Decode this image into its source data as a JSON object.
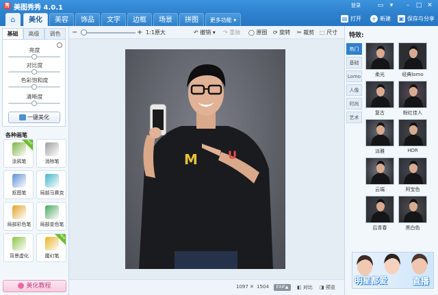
{
  "app": {
    "title": "美图秀秀 4.0.1",
    "login": "登录"
  },
  "nav": {
    "tabs": [
      "美化",
      "美容",
      "饰品",
      "文字",
      "边框",
      "场景",
      "拼图",
      "更多功能 ▾"
    ],
    "active_tab": "美化",
    "open_label": "打开",
    "new_label": "新建",
    "save_label": "保存与分享"
  },
  "left": {
    "subtabs": [
      "基础",
      "高级",
      "调色"
    ],
    "sliders": [
      {
        "label": "亮度",
        "value": 0.5
      },
      {
        "label": "对比度",
        "value": 0.5
      },
      {
        "label": "色彩饱和度",
        "value": 0.5
      },
      {
        "label": "清晰度",
        "value": 0.5
      }
    ],
    "one_click": "一键美化",
    "brush_section": "各种画笔",
    "tools": [
      {
        "label": "涂鸦笔",
        "badge": "NEW",
        "color": "#7cb342"
      },
      {
        "label": "消除笔",
        "badge": "",
        "color": "#9e9e9e"
      },
      {
        "label": "抠图笔",
        "badge": "",
        "color": "#5c8fd6"
      },
      {
        "label": "局部马赛克",
        "badge": "",
        "color": "#40b5c9"
      },
      {
        "label": "局部彩色笔",
        "badge": "",
        "color": "#e0a32a"
      },
      {
        "label": "局部变色笔",
        "badge": "",
        "color": "#4aa85c"
      },
      {
        "label": "背景虚化",
        "badge": "",
        "color": "#8bc34a"
      },
      {
        "label": "魔幻笔",
        "badge": "NEW",
        "color": "#e6b422"
      }
    ],
    "tutorial": "美化教程"
  },
  "toolbar": {
    "zoom_out": "−",
    "zoom_in": "+",
    "original_size": "1:1原大",
    "undo": "撤销",
    "redo": "重做",
    "original": "原图",
    "rotate": "旋转",
    "crop": "裁剪",
    "resize": "尺寸",
    "zoom_level": 0.02
  },
  "status": {
    "width": "1097",
    "x": "✕",
    "height": "1504",
    "exif": "EXIF▲",
    "compare": "对比",
    "preview": "预览"
  },
  "right": {
    "title": "特效:",
    "tabs": [
      "热门",
      "基础",
      "Lomo",
      "人像",
      "时尚",
      "艺术"
    ],
    "effects": [
      {
        "label": "柔光",
        "tone": "#565a64"
      },
      {
        "label": "经典lomo",
        "tone": "#2a2c30"
      },
      {
        "label": "复古",
        "tone": "#4a4d56"
      },
      {
        "label": "粉红佳人",
        "tone": "#5d4a5a"
      },
      {
        "label": "淡雅",
        "tone": "#6b6f78"
      },
      {
        "label": "HDR",
        "tone": "#42454c"
      },
      {
        "label": "云端",
        "tone": "#777b84"
      },
      {
        "label": "阿宝色",
        "tone": "#454a52"
      },
      {
        "label": "后青春",
        "tone": "#3f4248"
      },
      {
        "label": "黑白色",
        "tone": "#505050"
      }
    ],
    "ad": {
      "text": "明星都爱",
      "live": "直播"
    }
  },
  "colors": {
    "accent": "#2f80cc",
    "titlebar": "#3d94de",
    "panel": "#f2f7fc"
  }
}
